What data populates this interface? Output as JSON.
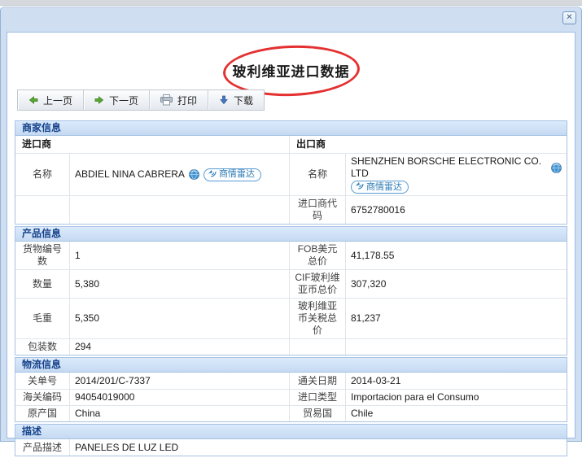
{
  "window": {
    "close_label": "✕"
  },
  "title": "玻利维亚进口数据",
  "toolbar": {
    "prev_label": "上一页",
    "next_label": "下一页",
    "print_label": "打印",
    "download_label": "下载"
  },
  "colors": {
    "section_header_text": "#15428b",
    "annotation_ellipse": "#e43030",
    "badge_blue": "#2e7cb5",
    "panel_border": "#99bbe8"
  },
  "merchant": {
    "header": "商家信息",
    "importer_header": "进口商",
    "exporter_header": "出口商",
    "importer_name_label": "名称",
    "importer_name": "ABDIEL NINA CABRERA",
    "importer_radar_badge": "商情雷达",
    "exporter_name_label": "名称",
    "exporter_name": "SHENZHEN BORSCHE ELECTRONIC CO. LTD",
    "exporter_radar_badge": "商情雷达",
    "importer_code_label": "进口商代码",
    "importer_code": "6752780016"
  },
  "product": {
    "header": "产品信息",
    "rows": [
      {
        "l1": "货物编号数",
        "v1": "1",
        "l2": "FOB美元总价",
        "v2": "41,178.55"
      },
      {
        "l1": "数量",
        "v1": "5,380",
        "l2": "CIF玻利维亚币总价",
        "v2": "307,320"
      },
      {
        "l1": "毛重",
        "v1": "5,350",
        "l2": "玻利维亚币关税总价",
        "v2": "81,237"
      },
      {
        "l1": "包装数",
        "v1": "294",
        "l2": "",
        "v2": ""
      }
    ]
  },
  "logistics": {
    "header": "物流信息",
    "rows": [
      {
        "l1": "关单号",
        "v1": "2014/201/C-7337",
        "l2": "通关日期",
        "v2": "2014-03-21"
      },
      {
        "l1": "海关编码",
        "v1": "94054019000",
        "l2": "进口类型",
        "v2": "Importacion para el Consumo"
      },
      {
        "l1": "原产国",
        "v1": "China",
        "l2": "贸易国",
        "v2": "Chile"
      }
    ]
  },
  "description": {
    "header": "描述",
    "label": "产品描述",
    "value": "PANELES DE LUZ LED"
  }
}
